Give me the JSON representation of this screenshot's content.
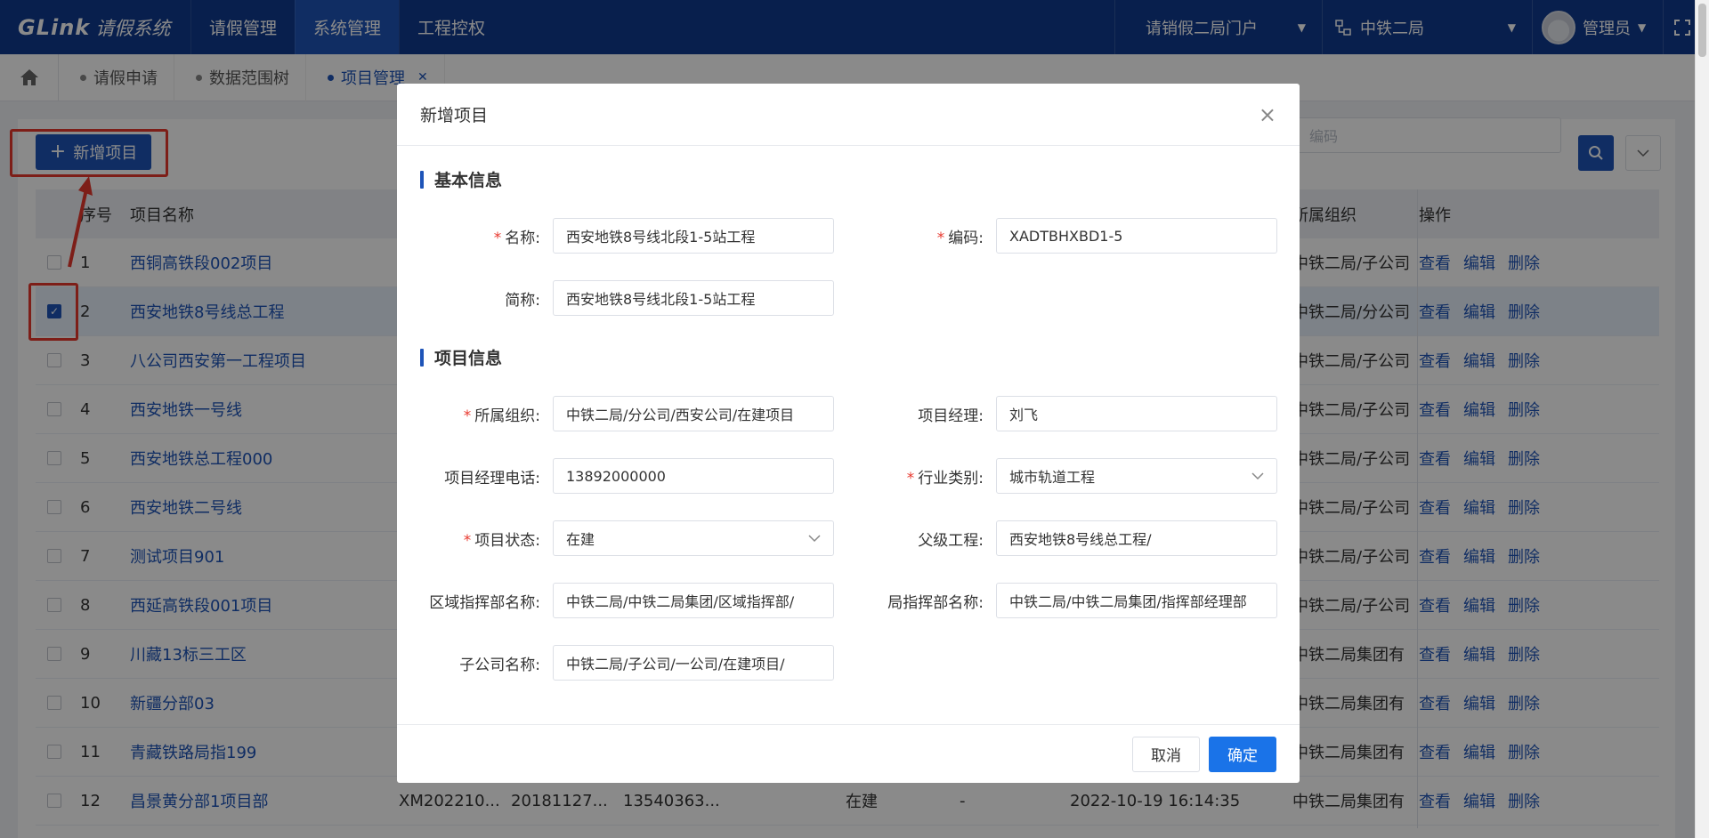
{
  "app": {
    "logo": "GLink",
    "system_name": "请假系统"
  },
  "nav": {
    "items": [
      "请假管理",
      "系统管理",
      "工程控权"
    ],
    "active_index": 1
  },
  "portal": {
    "label": "请销假二局门户"
  },
  "org": {
    "label": "中铁二局"
  },
  "user": {
    "name": "管理员"
  },
  "tabs": [
    {
      "label": "请假申请",
      "active": false
    },
    {
      "label": "数据范围树",
      "active": false
    },
    {
      "label": "项目管理",
      "active": true
    }
  ],
  "toolbar": {
    "add_label": "新增项目",
    "search_placeholder": "编码"
  },
  "table": {
    "headers": {
      "no": "序号",
      "name": "项目名称",
      "org": "所属组织",
      "ops": "操作"
    },
    "ops": [
      "查看",
      "编辑",
      "删除"
    ],
    "rows": [
      {
        "no": "1",
        "name": "西铜高铁段002项目",
        "org": "中铁二局/子公司",
        "checked": false
      },
      {
        "no": "2",
        "name": "西安地铁8号线总工程",
        "org": "中铁二局/分公司",
        "checked": true
      },
      {
        "no": "3",
        "name": "八公司西安第一工程项目",
        "org": "中铁二局/子公司",
        "checked": false
      },
      {
        "no": "4",
        "name": "西安地铁一号线",
        "org": "中铁二局/子公司",
        "checked": false
      },
      {
        "no": "5",
        "name": "西安地铁总工程000",
        "org": "中铁二局/子公司",
        "checked": false
      },
      {
        "no": "6",
        "name": "西安地铁二号线",
        "org": "中铁二局/子公司",
        "checked": false
      },
      {
        "no": "7",
        "name": "测试项目901",
        "org": "中铁二局/子公司",
        "checked": false
      },
      {
        "no": "8",
        "name": "西延高铁段001项目",
        "org": "中铁二局/子公司",
        "checked": false
      },
      {
        "no": "9",
        "name": "川藏13标三工区",
        "org": "中铁二局集团有",
        "checked": false
      },
      {
        "no": "10",
        "name": "新疆分部03",
        "org": "中铁二局集团有",
        "checked": false
      },
      {
        "no": "11",
        "name": "青藏铁路局指199",
        "org": "中铁二局集团有",
        "checked": false
      },
      {
        "no": "12",
        "name": "昌景黄分部1项目部",
        "code": "XM202210...",
        "date": "20181127...",
        "tel": "13540363...",
        "status": "在建",
        "dash": "-",
        "time": "2022-10-19 16:14:35",
        "org": "中铁二局集团有",
        "checked": false
      }
    ]
  },
  "modal": {
    "title": "新增项目",
    "section_basic": "基本信息",
    "section_project": "项目信息",
    "fields": {
      "name": {
        "label": "名称:",
        "value": "西安地铁8号线北段1-5站工程"
      },
      "code": {
        "label": "编码:",
        "value": "XADTBHXBD1-5"
      },
      "short": {
        "label": "简称:",
        "value": "西安地铁8号线北段1-5站工程"
      },
      "org": {
        "label": "所属组织:",
        "value": "中铁二局/分公司/西安公司/在建项目"
      },
      "manager": {
        "label": "项目经理:",
        "value": "刘飞"
      },
      "phone": {
        "label": "项目经理电话:",
        "value": "13892000000"
      },
      "industry": {
        "label": "行业类别:",
        "value": "城市轨道工程"
      },
      "status": {
        "label": "项目状态:",
        "value": "在建"
      },
      "parent": {
        "label": "父级工程:",
        "value": "西安地铁8号线总工程/"
      },
      "region": {
        "label": "区域指挥部名称:",
        "value": "中铁二局/中铁二局集团/区域指挥部/"
      },
      "bureau": {
        "label": "局指挥部名称:",
        "value": "中铁二局/中铁二局集团/指挥部经理部"
      },
      "subsidiary": {
        "label": "子公司名称:",
        "value": "中铁二局/子公司/一公司/在建项目/"
      }
    },
    "cancel_label": "取消",
    "ok_label": "确定"
  },
  "colors": {
    "nav_bg": "#0f3a8f",
    "primary": "#1e54b8",
    "ok_button": "#1a73e8",
    "annotation_red": "#e8382e"
  }
}
